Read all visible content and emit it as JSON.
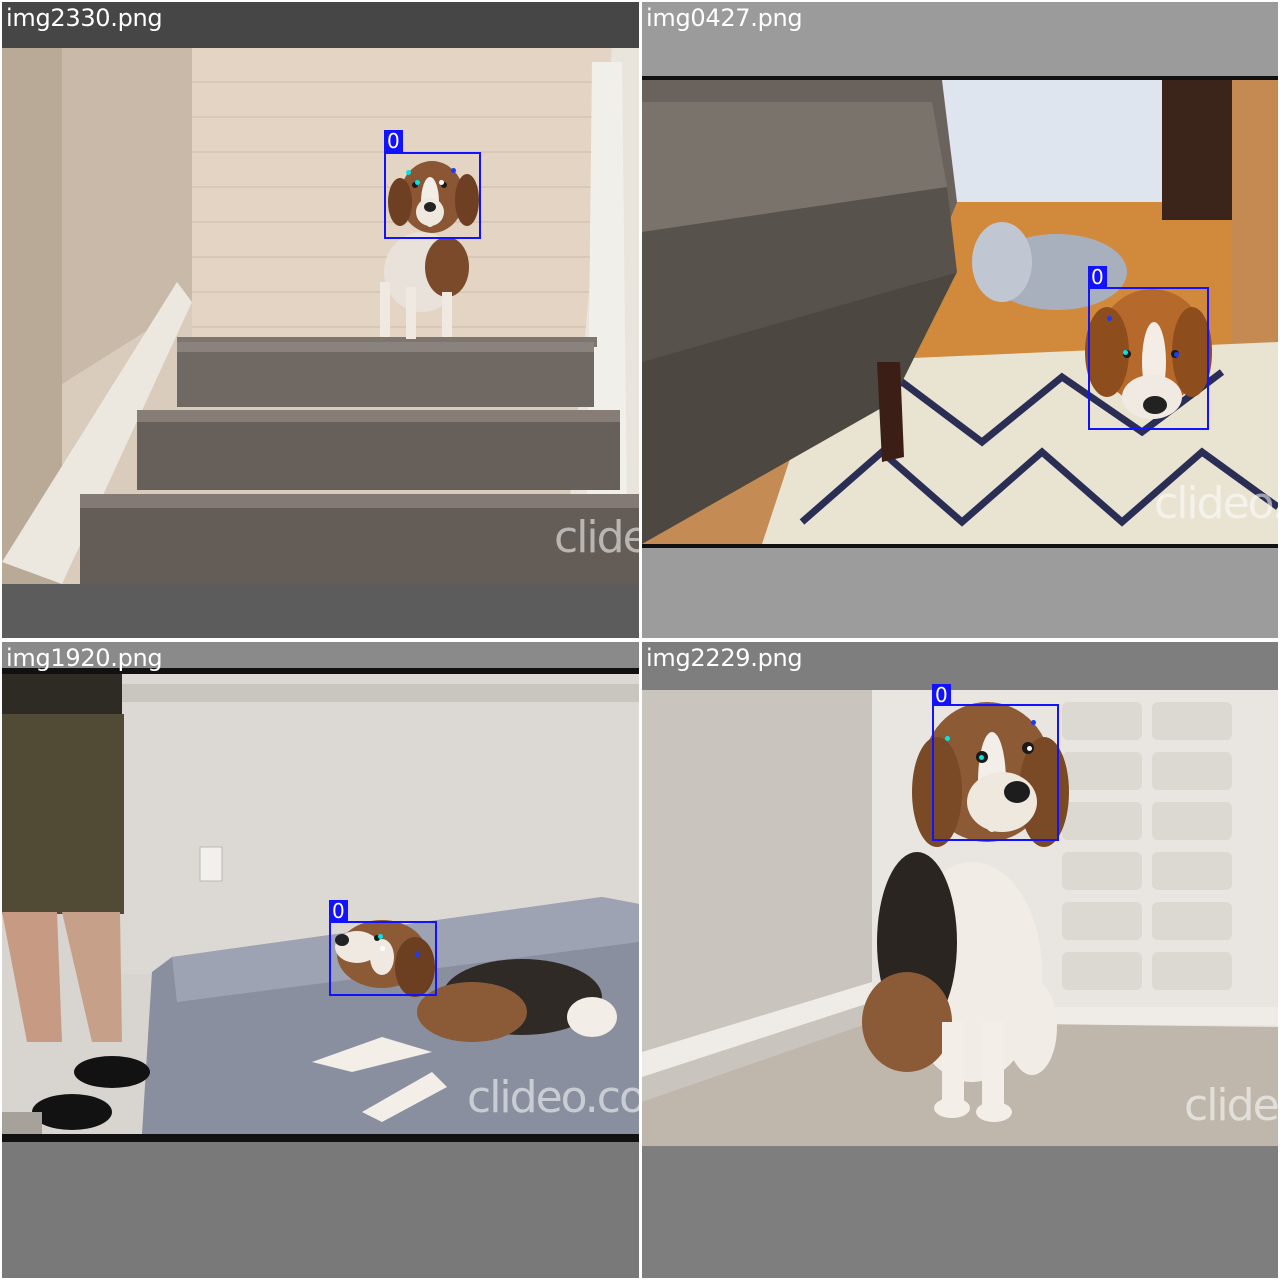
{
  "colors": {
    "box": "#1212ff",
    "kp_cyan": "#00e5e5",
    "kp_white": "#ffffff",
    "kp_blue": "#1a3cff"
  },
  "tiles": [
    {
      "filename": "img2330.png",
      "class_label": "0",
      "watermark": "clide"
    },
    {
      "filename": "img0427.png",
      "class_label": "0",
      "watermark": "clideo."
    },
    {
      "filename": "img1920.png",
      "class_label": "0",
      "watermark": "clideo.co"
    },
    {
      "filename": "img2229.png",
      "class_label": "0",
      "watermark": "clide"
    }
  ]
}
